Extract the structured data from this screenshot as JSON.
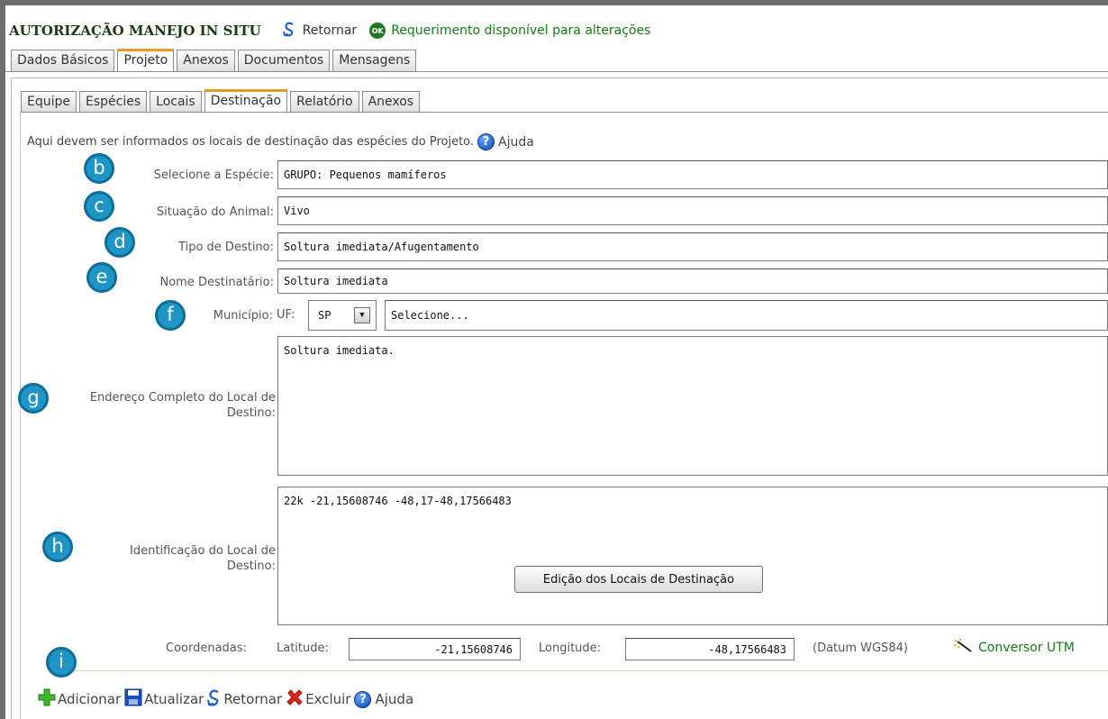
{
  "header": {
    "title": "AUTORIZAÇÃO MANEJO IN SITU",
    "back_label": "Retornar",
    "ok_badge": "OK",
    "status_text": "Requerimento disponível para alterações"
  },
  "top_tabs": [
    {
      "label": "Dados Básicos",
      "active": false
    },
    {
      "label": "Projeto",
      "active": true
    },
    {
      "label": "Anexos",
      "active": false
    },
    {
      "label": "Documentos",
      "active": false
    },
    {
      "label": "Mensagens",
      "active": false
    }
  ],
  "sub_tabs": [
    {
      "label": "Equipe",
      "active": false
    },
    {
      "label": "Espécies",
      "active": false
    },
    {
      "label": "Locais",
      "active": false
    },
    {
      "label": "Destinação",
      "active": true
    },
    {
      "label": "Relatório",
      "active": false
    },
    {
      "label": "Anexos",
      "active": false
    }
  ],
  "intro": {
    "text": "Aqui devem ser informados os locais de destinação das espécies do Projeto.",
    "help_label": "Ajuda",
    "help_glyph": "?"
  },
  "form": {
    "especie": {
      "label": "Selecione a Espécie:",
      "value": "GRUPO: Pequenos mamíferos"
    },
    "situacao": {
      "label": "Situação do Animal:",
      "value": "Vivo"
    },
    "tipo_destino": {
      "label": "Tipo de Destino:",
      "value": "Soltura imediata/Afugentamento"
    },
    "nome_destinatario": {
      "label": "Nome Destinatário:",
      "value": "Soltura imediata"
    },
    "municipio": {
      "label": "Município:",
      "uf_label": "UF:",
      "uf_value": "SP",
      "city_value": "Selecione..."
    },
    "endereco": {
      "label": "Endereço Completo do Local de Destino:",
      "value": "Soltura imediata."
    },
    "identificacao": {
      "label": "Identificação do Local de Destino:",
      "value": "22k -21,15608746 -48,17-48,17566483",
      "edit_button": "Edição dos Locais de Destinação"
    },
    "coordenadas": {
      "label": "Coordenadas:",
      "lat_label": "Latitude:",
      "lat_value": "-21,15608746",
      "lon_label": "Longitude:",
      "lon_value": "-48,17566483",
      "datum": "(Datum WGS84)",
      "converter": "Conversor UTM"
    }
  },
  "badges": [
    "b",
    "c",
    "d",
    "e",
    "f",
    "g",
    "h",
    "i"
  ],
  "toolbar": {
    "add": "Adicionar",
    "update": "Atualizar",
    "back": "Retornar",
    "delete": "Excluir",
    "help": "Ajuda"
  },
  "colors": {
    "status_green": "#177a17",
    "tab_accent": "#e89a24",
    "badge_blue": "#1f95c6"
  }
}
